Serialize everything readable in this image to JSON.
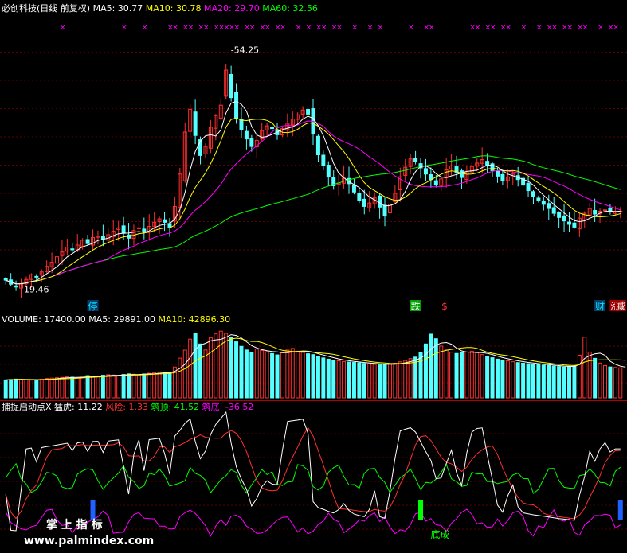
{
  "chart_data": [
    {
      "type": "candlestick",
      "title": "必创科技(日线 前复权)",
      "legend": [
        {
          "label": "MA5: 30.77",
          "color": "#ffffff"
        },
        {
          "label": "MA10: 30.78",
          "color": "#ffff00"
        },
        {
          "label": "MA20: 29.70",
          "color": "#ff00ff"
        },
        {
          "label": "MA60: 32.56",
          "color": "#00ff00"
        }
      ],
      "annotations": {
        "high": "54.25",
        "low": "19.46"
      },
      "markers": [
        {
          "label": "停",
          "index": 17,
          "color": "#00e5ff",
          "bg": "#0a3a66"
        },
        {
          "label": "跌",
          "index": 80,
          "color": "#ffffff",
          "bg": "#00a000"
        },
        {
          "label": "$",
          "index": 86,
          "color": "#ff3030",
          "bg": ""
        },
        {
          "label": "财",
          "index": 116,
          "color": "#00e5ff",
          "bg": "#0a3a66"
        },
        {
          "label": "涨",
          "index": 119,
          "color": "#ffffff",
          "bg": "#a00000"
        },
        {
          "label": "减",
          "index": 121,
          "color": "#ffffff",
          "bg": "#a00000"
        }
      ],
      "x_top_marks": "×",
      "colors": {
        "up": "#ff3030",
        "down": "#54ffff",
        "ma5": "#ffffff",
        "ma10": "#ffff00",
        "ma20": "#ff00ff",
        "ma60": "#00ff00"
      },
      "ylim": [
        17,
        58
      ],
      "close": [
        20.8,
        20.2,
        19.8,
        20.3,
        20.9,
        21.6,
        21.3,
        22.0,
        22.8,
        23.4,
        24.2,
        24.9,
        25.6,
        25.2,
        25.9,
        26.6,
        26.1,
        27.0,
        27.2,
        26.8,
        27.4,
        27.9,
        28.4,
        27.6,
        26.9,
        28.0,
        28.4,
        27.8,
        28.6,
        29.2,
        29.7,
        29.2,
        28.5,
        31.5,
        36.2,
        42.3,
        45.6,
        41.8,
        38.9,
        40.2,
        43.0,
        44.7,
        46.2,
        51.3,
        47.3,
        44.2,
        42.6,
        41.3,
        40.2,
        41.1,
        42.5,
        43.2,
        42.8,
        41.9,
        42.8,
        43.6,
        44.2,
        44.8,
        45.5,
        44.9,
        42.0,
        39.0,
        37.5,
        35.8,
        34.5,
        34.9,
        35.6,
        34.8,
        33.6,
        32.4,
        31.5,
        32.0,
        32.8,
        31.4,
        30.1,
        31.8,
        33.4,
        35.8,
        37.2,
        38.4,
        38.0,
        37.1,
        36.2,
        35.4,
        34.6,
        35.5,
        36.8,
        37.4,
        36.4,
        35.7,
        36.6,
        37.3,
        37.8,
        38.3,
        37.4,
        36.7,
        35.9,
        35.2,
        35.8,
        36.2,
        35.4,
        34.6,
        33.8,
        33.0,
        32.4,
        31.8,
        31.2,
        30.5,
        29.9,
        29.4,
        28.9,
        28.5,
        29.8,
        30.5,
        31.2,
        30.4,
        30.8,
        31.0,
        30.7,
        30.8,
        30.8
      ],
      "volume": [
        17400,
        17800,
        18200,
        17900,
        17600,
        17200,
        17500,
        18000,
        18800,
        19100,
        19500,
        19800,
        20300,
        20000,
        19700,
        20100,
        21500,
        20800,
        21200,
        21900,
        22400,
        22100,
        21800,
        22600,
        23200,
        22900,
        22500,
        23100,
        23800,
        24400,
        25100,
        24700,
        24200,
        29800,
        38400,
        46200,
        56800,
        62000,
        52100,
        46300,
        58200,
        61800,
        64500,
        62300,
        58700,
        54200,
        49800,
        46300,
        43800,
        47200,
        45900,
        44600,
        42800,
        41500,
        43600,
        46200,
        47800,
        45100,
        43900,
        42600,
        41800,
        40200,
        38600,
        37400,
        36300,
        35800,
        35100,
        34600,
        34200,
        33800,
        33300,
        32800,
        32400,
        31900,
        32300,
        32700,
        33500,
        34800,
        36100,
        37900,
        39400,
        44200,
        52100,
        61600,
        57200,
        50100,
        46300,
        44100,
        42900,
        43700,
        44400,
        45100,
        43500,
        41800,
        40200,
        38800,
        37400,
        36600,
        35800,
        34900,
        34100,
        33500,
        33000,
        32600,
        32100,
        31600,
        31200,
        30700,
        30300,
        29800,
        30200,
        30600,
        41200,
        58600,
        44300,
        38200,
        33600,
        31200,
        29900,
        29400,
        29100,
        28800
      ],
      "volume_legend": [
        {
          "label": "VOLUME: 17400.00",
          "color": "#ffffff"
        },
        {
          "label": "MA5: 29891.00",
          "color": "#ffffff"
        },
        {
          "label": "MA10: 42896.30",
          "color": "#ffff00"
        }
      ],
      "indicator_legend": [
        {
          "label": "捕捉启动点X",
          "color": "#ffffff"
        },
        {
          "label": "猛虎: 11.22",
          "color": "#ffffff"
        },
        {
          "label": "风险: 1.33",
          "color": "#ff3030"
        },
        {
          "label": "筑顶: 41.52",
          "color": "#00ff00"
        },
        {
          "label": "筑底: -36.52",
          "color": "#ff00ff"
        }
      ],
      "indicator_texts": {
        "bottom_signal": "底成",
        "watermark_cn": "掌 上 指 标",
        "watermark_url": "www.palmindex.com"
      }
    }
  ]
}
